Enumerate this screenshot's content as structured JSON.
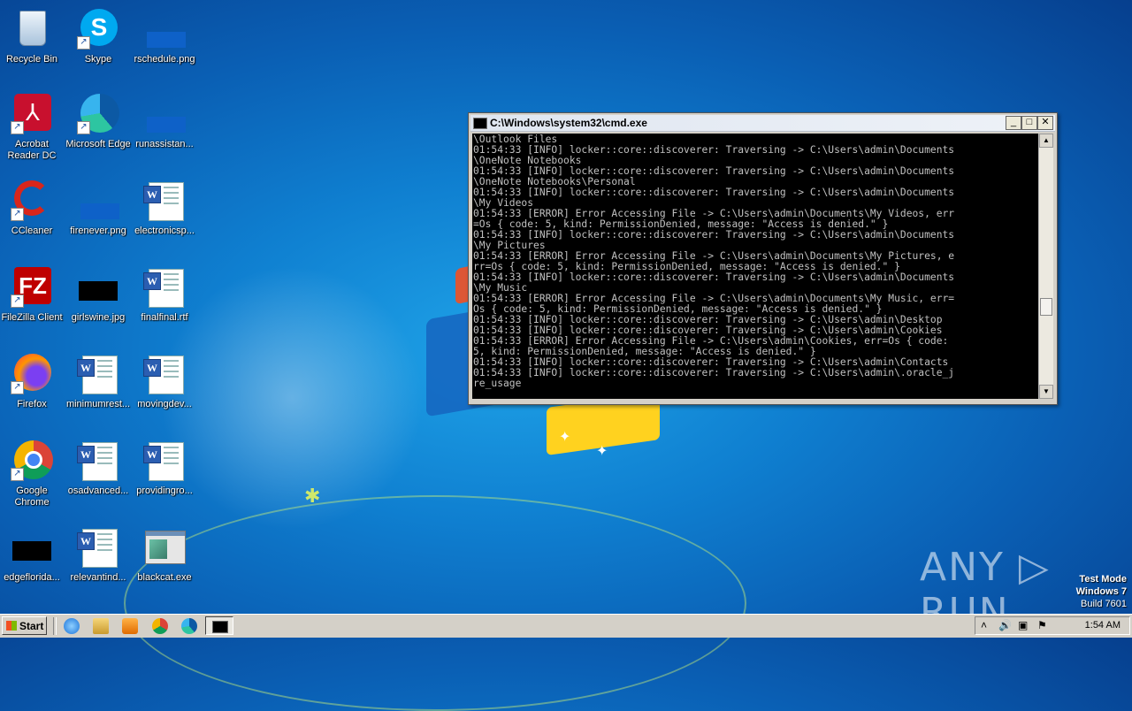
{
  "desktop": {
    "icons": [
      {
        "label": "Recycle Bin",
        "icon": "recycle-bin-icon"
      },
      {
        "label": "Skype",
        "icon": "skype-icon"
      },
      {
        "label": "rschedule.png",
        "icon": "image-file-icon"
      },
      {
        "label": "Acrobat\nReader DC",
        "icon": "acrobat-icon"
      },
      {
        "label": "Microsoft Edge",
        "icon": "edge-icon"
      },
      {
        "label": "runassistan...",
        "icon": "image-file-icon"
      },
      {
        "label": "CCleaner",
        "icon": "ccleaner-icon"
      },
      {
        "label": "firenever.png",
        "icon": "image-file-icon"
      },
      {
        "label": "electronicsp...",
        "icon": "word-doc-icon"
      },
      {
        "label": "FileZilla Client",
        "icon": "filezilla-icon"
      },
      {
        "label": "girlswine.jpg",
        "icon": "image-file-icon"
      },
      {
        "label": "finalfinal.rtf",
        "icon": "word-doc-icon"
      },
      {
        "label": "Firefox",
        "icon": "firefox-icon"
      },
      {
        "label": "minimumrest...",
        "icon": "word-doc-icon"
      },
      {
        "label": "movingdev...",
        "icon": "word-doc-icon"
      },
      {
        "label": "Google\nChrome",
        "icon": "chrome-icon"
      },
      {
        "label": "osadvanced...",
        "icon": "word-doc-icon"
      },
      {
        "label": "providingro...",
        "icon": "word-doc-icon"
      },
      {
        "label": "edgeflorida...",
        "icon": "image-file-icon"
      },
      {
        "label": "relevantind...",
        "icon": "word-doc-icon"
      },
      {
        "label": "blackcat.exe",
        "icon": "exe-icon"
      }
    ]
  },
  "cmd": {
    "title": "C:\\Windows\\system32\\cmd.exe",
    "buttons": {
      "minimize": "_",
      "maximize": "□",
      "close": "✕"
    },
    "output": "\\Outlook Files\n01:54:33 [INFO] locker::core::discoverer: Traversing -> C:\\Users\\admin\\Documents\n\\OneNote Notebooks\n01:54:33 [INFO] locker::core::discoverer: Traversing -> C:\\Users\\admin\\Documents\n\\OneNote Notebooks\\Personal\n01:54:33 [INFO] locker::core::discoverer: Traversing -> C:\\Users\\admin\\Documents\n\\My Videos\n01:54:33 [ERROR] Error Accessing File -> C:\\Users\\admin\\Documents\\My Videos, err\n=Os { code: 5, kind: PermissionDenied, message: \"Access is denied.\" }\n01:54:33 [INFO] locker::core::discoverer: Traversing -> C:\\Users\\admin\\Documents\n\\My Pictures\n01:54:33 [ERROR] Error Accessing File -> C:\\Users\\admin\\Documents\\My Pictures, e\nrr=Os { code: 5, kind: PermissionDenied, message: \"Access is denied.\" }\n01:54:33 [INFO] locker::core::discoverer: Traversing -> C:\\Users\\admin\\Documents\n\\My Music\n01:54:33 [ERROR] Error Accessing File -> C:\\Users\\admin\\Documents\\My Music, err=\nOs { code: 5, kind: PermissionDenied, message: \"Access is denied.\" }\n01:54:33 [INFO] locker::core::discoverer: Traversing -> C:\\Users\\admin\\Desktop\n01:54:33 [INFO] locker::core::discoverer: Traversing -> C:\\Users\\admin\\Cookies\n01:54:33 [ERROR] Error Accessing File -> C:\\Users\\admin\\Cookies, err=Os { code:\n5, kind: PermissionDenied, message: \"Access is denied.\" }\n01:54:33 [INFO] locker::core::discoverer: Traversing -> C:\\Users\\admin\\Contacts\n01:54:33 [INFO] locker::core::discoverer: Traversing -> C:\\Users\\admin\\.oracle_j\nre_usage"
  },
  "watermark": {
    "brand": "ANY ▷ RUN"
  },
  "os_badge": {
    "line1": "Test Mode",
    "line2": "Windows 7",
    "line3": "Build 7601"
  },
  "taskbar": {
    "start_label": "Start",
    "pinned": [
      "ie-icon",
      "explorer-icon",
      "media-player-icon",
      "chrome-icon",
      "edge-icon"
    ],
    "active_window": "cmd-icon",
    "tray_icons": [
      "chevron-up-icon",
      "volume-icon",
      "network-icon",
      "action-center-flag-icon"
    ],
    "clock": "1:54 AM"
  },
  "colors": {
    "desktop_blue": "#0f7fd0",
    "console_bg": "#000000",
    "console_fg": "#c0c0c0",
    "taskbar": "#d4d0c8"
  }
}
